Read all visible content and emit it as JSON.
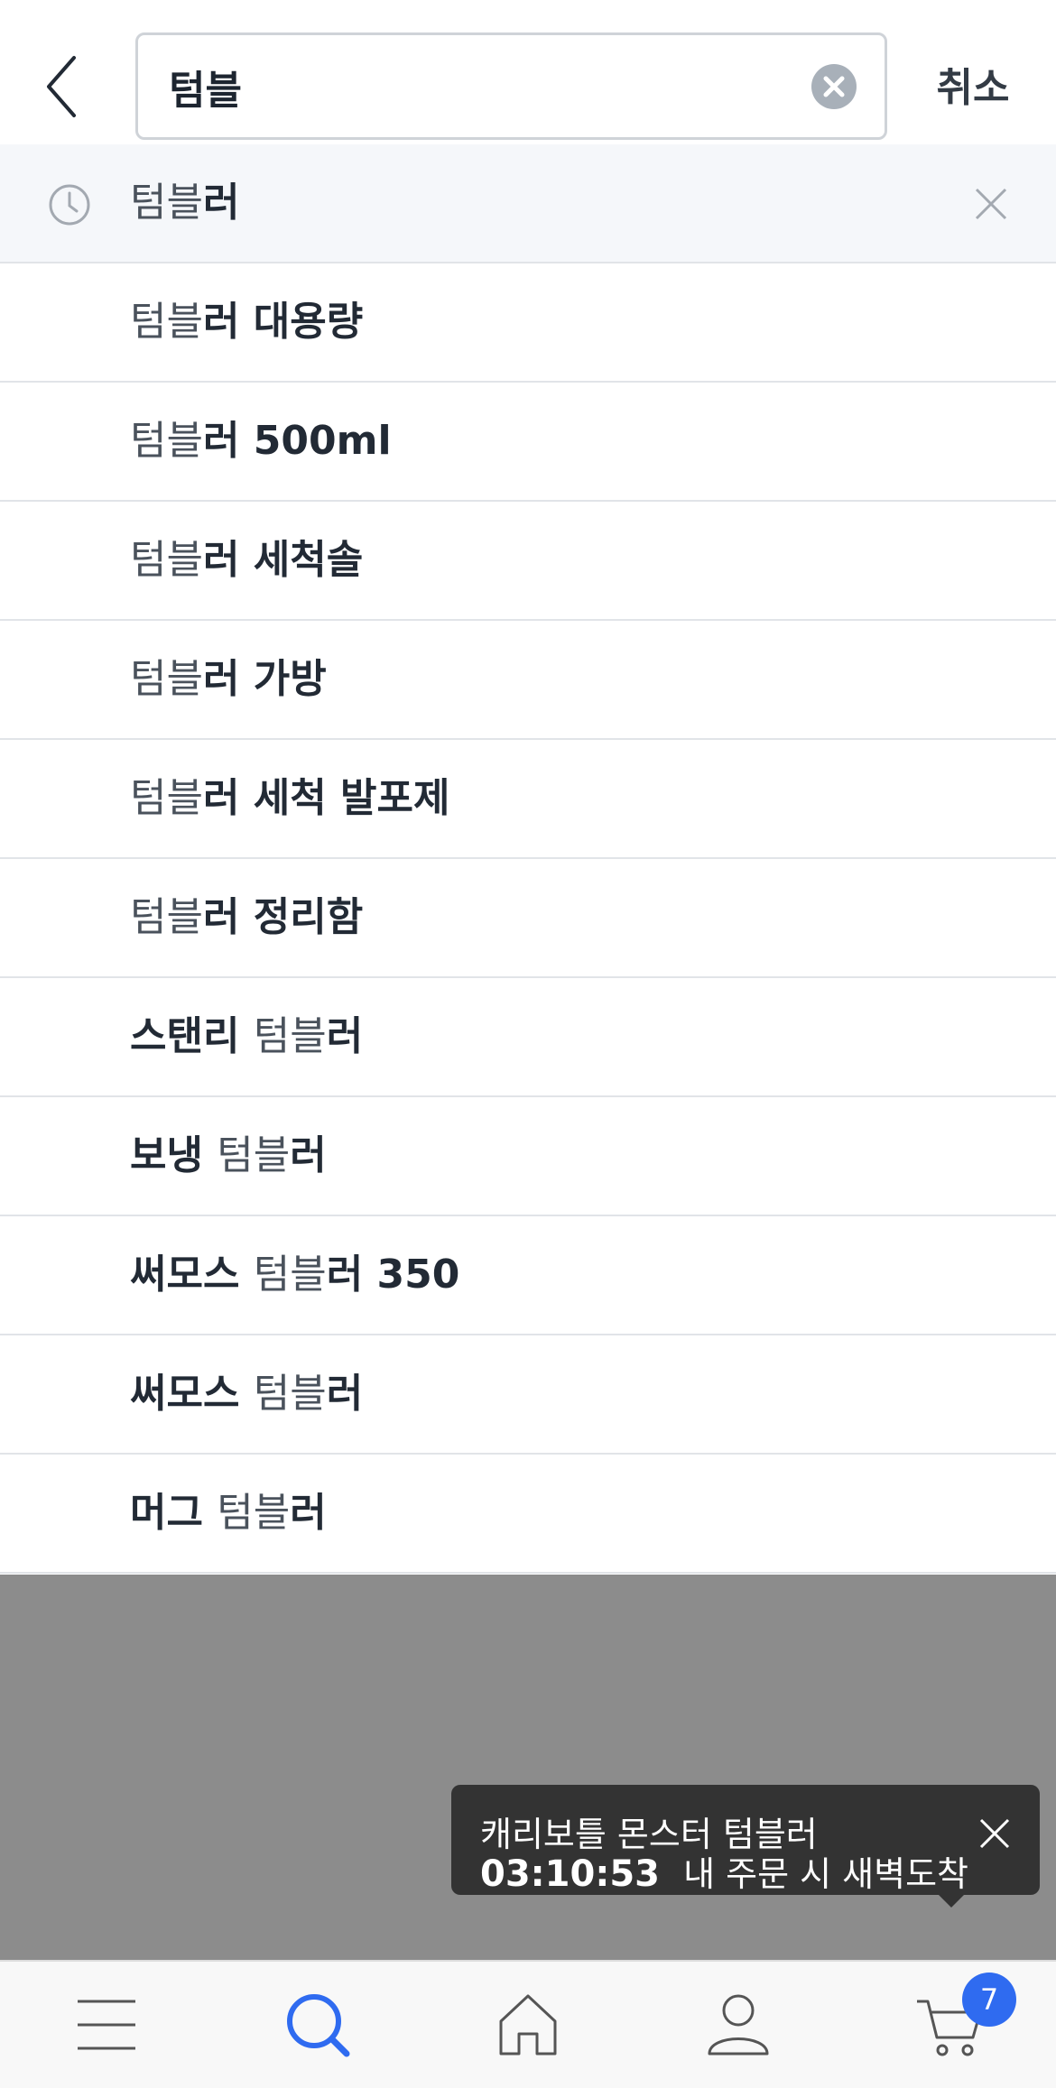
{
  "header": {
    "search_value": "텀블",
    "cancel_label": "취소"
  },
  "suggestions": [
    {
      "match": "텀블",
      "rest": "러",
      "recent": true
    },
    {
      "match": "텀블",
      "rest": "러 대용량"
    },
    {
      "match": "텀블",
      "rest": "러 500ml"
    },
    {
      "match": "텀블",
      "rest": "러 세척솔"
    },
    {
      "match": "텀블",
      "rest": "러 가방"
    },
    {
      "match": "텀블",
      "rest": "러 세척 발포제"
    },
    {
      "match": "텀블",
      "rest": "러 정리함"
    },
    {
      "prefix": "스탠리 ",
      "match": "텀블",
      "rest": "러"
    },
    {
      "prefix": "보냉 ",
      "match": "텀블",
      "rest": "러"
    },
    {
      "prefix": "써모스 ",
      "match": "텀블",
      "rest": "러 350"
    },
    {
      "prefix": "써모스 ",
      "match": "텀블",
      "rest": "러"
    },
    {
      "prefix": "머그 ",
      "match": "텀블",
      "rest": "러"
    }
  ],
  "tooltip": {
    "product": "캐리보틀 몬스터 텀블러",
    "timer": "03:10:53",
    "message": "내 주문 시 새벽도착"
  },
  "bottom_nav": {
    "items": [
      "menu-icon",
      "search-icon",
      "home-icon",
      "profile-icon",
      "cart-icon"
    ],
    "cart_badge": "7"
  },
  "colors": {
    "accent": "#2f6bf0",
    "recent_row_bg": "#f5f7fa",
    "overlay": "#8c8c8c",
    "tooltip_bg": "#333333"
  }
}
